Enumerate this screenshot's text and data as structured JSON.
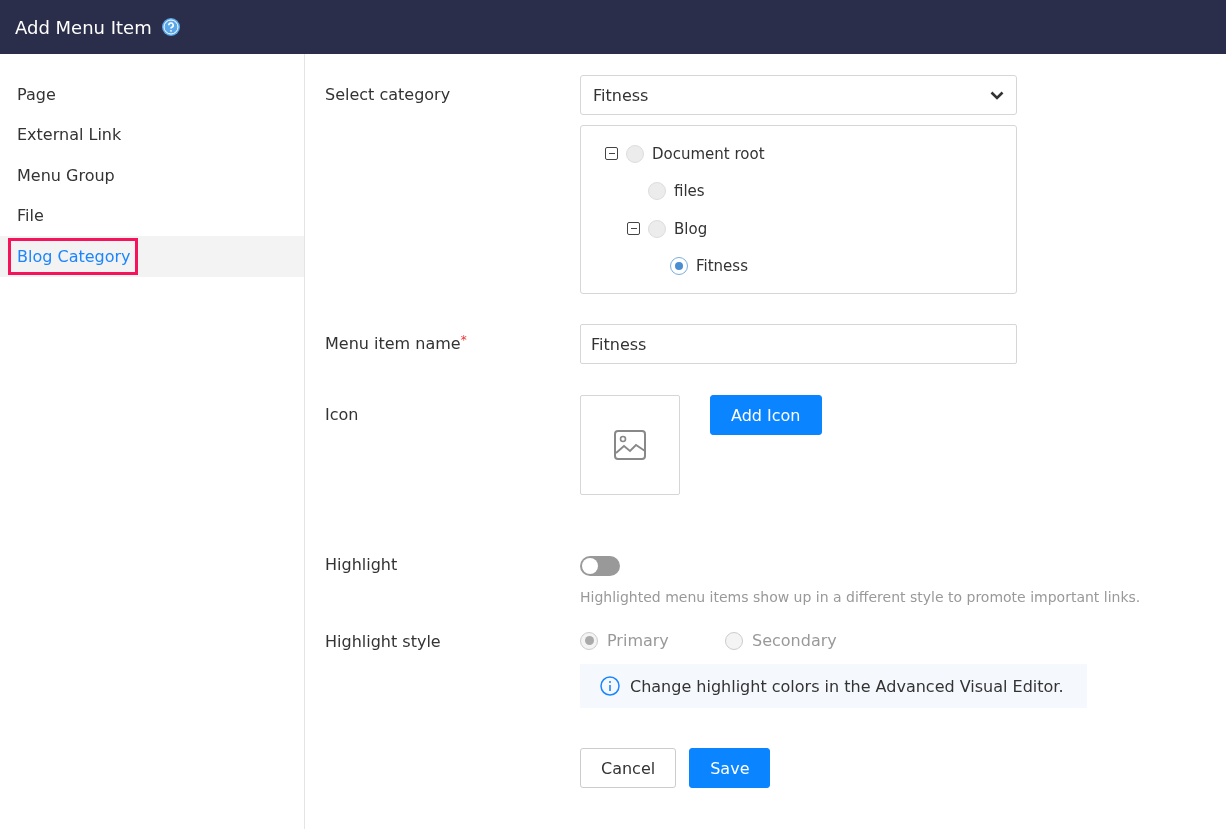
{
  "header": {
    "title": "Add Menu Item"
  },
  "sidebar": {
    "items": [
      {
        "label": "Page",
        "selected": false,
        "outlined": false
      },
      {
        "label": "External Link",
        "selected": false,
        "outlined": false
      },
      {
        "label": "Menu Group",
        "selected": false,
        "outlined": false
      },
      {
        "label": "File",
        "selected": false,
        "outlined": false
      },
      {
        "label": "Blog Category",
        "selected": true,
        "outlined": true
      }
    ]
  },
  "form": {
    "category": {
      "label": "Select category",
      "value": "Fitness",
      "tree": [
        {
          "label": "Document root",
          "selected": false,
          "expanded": true,
          "children": [
            {
              "label": "files",
              "selected": false
            },
            {
              "label": "Blog",
              "selected": false,
              "expanded": true,
              "children": [
                {
                  "label": "Fitness",
                  "selected": true
                }
              ]
            }
          ]
        }
      ]
    },
    "name": {
      "label": "Menu item name",
      "required_mark": "*",
      "value": "Fitness"
    },
    "icon": {
      "label": "Icon",
      "button": "Add Icon"
    },
    "highlight": {
      "label": "Highlight",
      "on": false,
      "help": "Highlighted menu items show up in a different style to promote important links."
    },
    "highlight_style": {
      "label": "Highlight style",
      "disabled": true,
      "options": [
        {
          "label": "Primary",
          "selected": true
        },
        {
          "label": "Secondary",
          "selected": false
        }
      ],
      "info": "Change highlight colors in the Advanced Visual Editor."
    },
    "buttons": [
      {
        "label": "Cancel",
        "kind": "secondary"
      },
      {
        "label": "Save",
        "kind": "primary"
      }
    ]
  }
}
